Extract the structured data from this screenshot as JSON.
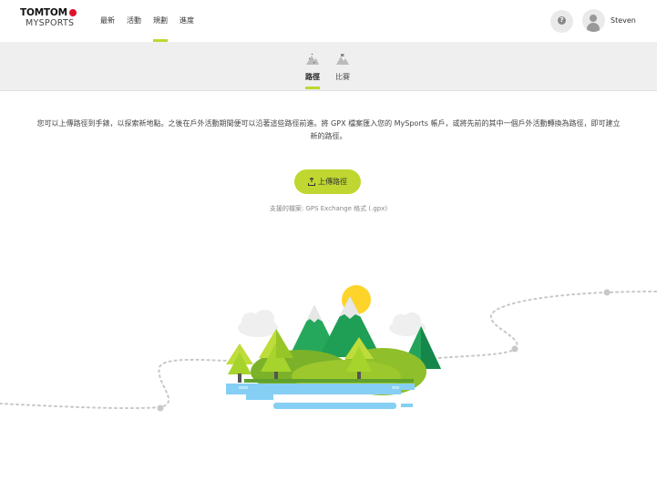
{
  "header": {
    "logo_top": "TOMTOM",
    "logo_bottom": "MYSPORTS",
    "nav": [
      {
        "label": "最新",
        "active": false
      },
      {
        "label": "活動",
        "active": false
      },
      {
        "label": "規劃",
        "active": true
      },
      {
        "label": "進度",
        "active": false
      }
    ],
    "help_icon": "question-icon",
    "user_name": "Steven"
  },
  "subnav": {
    "tabs": [
      {
        "label": "路徑",
        "icon": "route-icon",
        "active": true
      },
      {
        "label": "比賽",
        "icon": "race-icon",
        "active": false
      }
    ]
  },
  "main": {
    "description": "您可以上傳路徑到手錶，以探索新地點。之後在戶外活動期間便可以沿著這些路徑前進。將 GPX 檔案匯入您的 MySports 帳戶，或將先前的其中一個戶外活動轉換為路徑，即可建立新的路徑。",
    "upload_label": "上傳路徑",
    "upload_icon": "upload-icon",
    "supported_formats": "支援的檔案: GPS Exchange 格式 (.gpx)"
  },
  "colors": {
    "accent": "#bfd730",
    "subnav_bg": "#efefef",
    "water": "#7ecdf5",
    "sun": "#ffd42a",
    "tree_light": "#a6d42c",
    "tree_dark": "#1fa35c"
  }
}
